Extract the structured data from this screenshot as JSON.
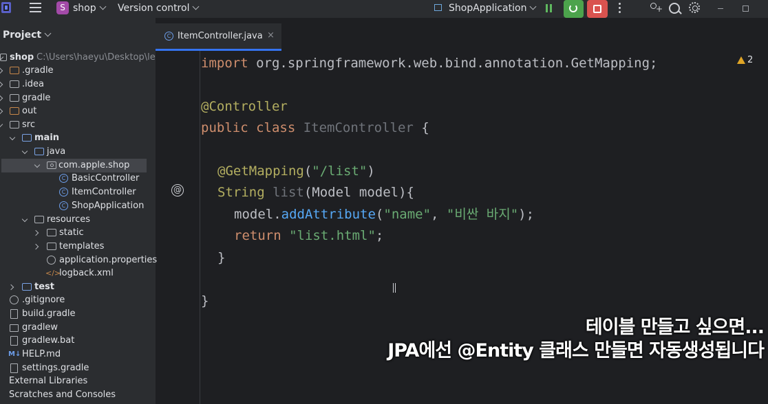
{
  "titlebar": {
    "project_badge": "S",
    "project_name": "shop",
    "vcs_label": "Version control",
    "run_config": "ShopApplication"
  },
  "sidebar": {
    "title": "Project",
    "tree": [
      {
        "label": "shop",
        "path": "C:\\Users\\haeyu\\Desktop\\le"
      },
      {
        "label": ".gradle"
      },
      {
        "label": ".idea"
      },
      {
        "label": "gradle"
      },
      {
        "label": "out"
      },
      {
        "label": "src"
      },
      {
        "label": "main"
      },
      {
        "label": "java"
      },
      {
        "label": "com.apple.shop"
      },
      {
        "label": "BasicController"
      },
      {
        "label": "ItemController"
      },
      {
        "label": "ShopApplication"
      },
      {
        "label": "resources"
      },
      {
        "label": "static"
      },
      {
        "label": "templates"
      },
      {
        "label": "application.properties"
      },
      {
        "label": "logback.xml"
      },
      {
        "label": "test"
      },
      {
        "label": ".gitignore"
      },
      {
        "label": "build.gradle"
      },
      {
        "label": "gradlew"
      },
      {
        "label": "gradlew.bat"
      },
      {
        "label": "HELP.md"
      },
      {
        "label": "settings.gradle"
      },
      {
        "label": "External Libraries"
      },
      {
        "label": "Scratches and Consoles"
      }
    ]
  },
  "editor": {
    "tab_label": "ItemController.java",
    "tab_close": "×",
    "tab_icon_letter": "C",
    "warning_count": "2",
    "gutter_icon": "@",
    "code": {
      "l1_kw": "import",
      "l1_rest": " org.springframework.web.bind.annotation.GetMapping;",
      "l2_ann": "@Controller",
      "l3_kw": "public class",
      "l3_name": " ItemController",
      "l3_brace": " {",
      "l4_ann": "@GetMapping",
      "l4_open": "(",
      "l4_str": "\"/list\"",
      "l4_close": ")",
      "l5_type": "String",
      "l5_name": " list",
      "l5_rest": "(Model model){",
      "l6_obj": "model.",
      "l6_fn": "addAttribute",
      "l6_open": "(",
      "l6_s1": "\"name\"",
      "l6_comma": ", ",
      "l6_s2": "\"비싼 바지\"",
      "l6_close": ");",
      "l7_kw": "return",
      "l7_str": " \"list.html\"",
      "l7_semi": ";",
      "l8": "}",
      "l9": "}"
    }
  },
  "subtitles": {
    "line1": "테이블 만들고 싶으면...",
    "line2": "JPA에선 @Entity 클래스 만들면 자동생성됩니다"
  }
}
